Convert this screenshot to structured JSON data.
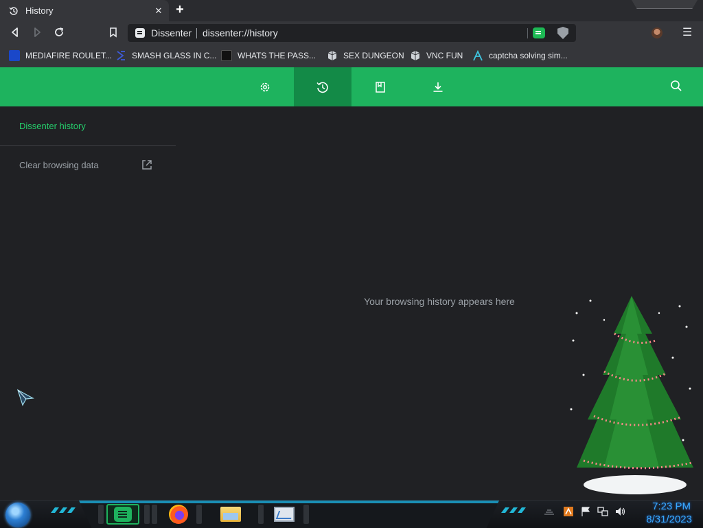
{
  "tab": {
    "title": "History",
    "icon": "history-icon",
    "close_glyph": "✕"
  },
  "toolbar": {
    "back_icon": "back-icon",
    "forward_icon": "forward-icon",
    "reload_icon": "reload-icon",
    "bookmark_icon": "bookmark-icon",
    "omnibox": {
      "site_name": "Dissenter",
      "url": "dissenter://history"
    },
    "menu_glyph": "☰"
  },
  "bookmarks": [
    {
      "label": "MEDIAFIRE ROULET...",
      "icon": "mediafire-icon",
      "color": "#1a47c9"
    },
    {
      "label": "SMASH GLASS IN C...",
      "icon": "smash-glass-icon",
      "color": "#3d5bd9"
    },
    {
      "label": "WHATS THE PASS...",
      "icon": "black-square-icon",
      "color": "#111111"
    },
    {
      "label": "SEX DUNGEON",
      "icon": "cube-icon",
      "color": "#cfd3d8"
    },
    {
      "label": "VNC FUN",
      "icon": "cube-icon",
      "color": "#cfd3d8"
    },
    {
      "label": "captcha solving sim...",
      "icon": "lambda-icon",
      "color": "#3ec6e0"
    }
  ],
  "navbar": {
    "items": [
      {
        "name": "settings",
        "icon": "gear-icon",
        "active": false
      },
      {
        "name": "history",
        "icon": "history-icon",
        "active": true
      },
      {
        "name": "bookmarks",
        "icon": "bookmark-icon",
        "active": false
      },
      {
        "name": "downloads",
        "icon": "download-icon",
        "active": false
      }
    ],
    "search_icon": "search-icon",
    "color": "#1eb35e",
    "active_color": "#138a47"
  },
  "sidebar": {
    "title": "Dissenter history",
    "clear_label": "Clear browsing data",
    "title_color": "#25cd6b"
  },
  "main": {
    "empty_message": "Your browsing history appears here"
  },
  "taskbar": {
    "apps": [
      "dissenter",
      "firefox",
      "file-explorer",
      "system-monitor"
    ],
    "clock_time": "7:23 PM",
    "clock_date": "8/31/2023",
    "clock_color": "#39a9ff"
  }
}
